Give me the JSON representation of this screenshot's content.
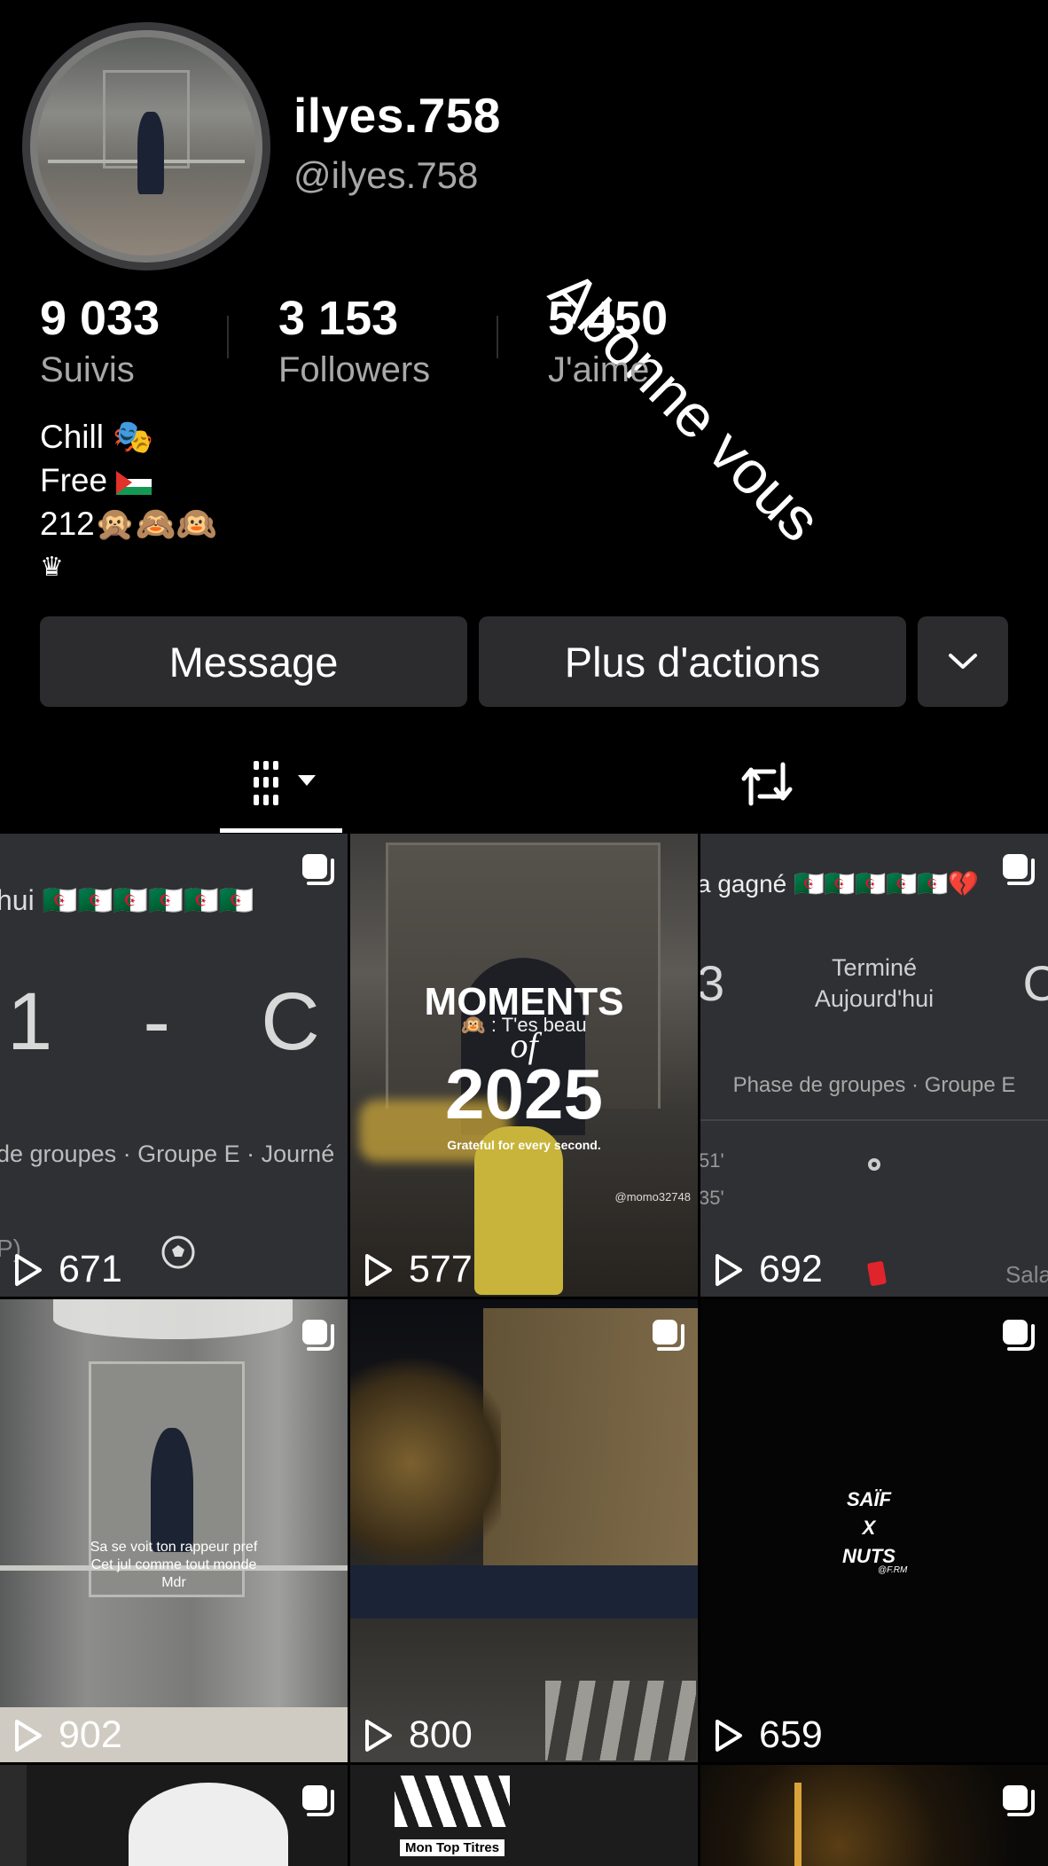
{
  "profile": {
    "display_name": "ilyes.758",
    "handle": "@ilyes.758",
    "overlay_text": "Abonne vous",
    "stats": [
      {
        "value": "9 033",
        "label": "Suivis"
      },
      {
        "value": "3 153",
        "label": "Followers"
      },
      {
        "value": "5 450",
        "label": "J'aime"
      }
    ],
    "bio": {
      "line1": "Chill 🎭",
      "line2": "Free",
      "line3": "212🙊🙈🙉",
      "line4": "♛"
    }
  },
  "actions": {
    "message_label": "Message",
    "more_label": "Plus d'actions"
  },
  "videos": [
    {
      "views": "671",
      "texts": {
        "top": "hui 🇩🇿🇩🇿🇩🇿🇩🇿🇩🇿🇩🇿",
        "score": "1    -    C",
        "sub": "de groupes · Groupe E · Journé",
        "corner": "P)"
      }
    },
    {
      "views": "577",
      "texts": {
        "a": "MOMENTS",
        "b": "of",
        "c": "2025",
        "d": "Grateful for every second.",
        "e": "🙉 : T'es beau",
        "tag": "@momo32748"
      }
    },
    {
      "views": "692",
      "texts": {
        "top": "a gagné 🇩🇿🇩🇿🇩🇿🇩🇿🇩🇿💔",
        "status1": "Terminé",
        "status2": "Aujourd'hui",
        "left": "3",
        "right": "C",
        "phase": "Phase de groupes · Groupe E",
        "m1": "51'",
        "m2": "35'",
        "sala": "Sala"
      }
    },
    {
      "views": "902",
      "texts": {
        "cap1": "Sa se voit ton rappeur pref",
        "cap2": "Cet jul comme tout monde",
        "cap3": "Mdr"
      }
    },
    {
      "views": "800",
      "texts": {}
    },
    {
      "views": "659",
      "texts": {
        "l1": "SAÏF",
        "l2": "X",
        "l3": "NUTS",
        "l4": "@F.RM"
      }
    },
    {
      "views": "",
      "texts": {}
    },
    {
      "views": "",
      "texts": {
        "label": "Mon Top Titres"
      }
    },
    {
      "views": "",
      "texts": {}
    }
  ]
}
